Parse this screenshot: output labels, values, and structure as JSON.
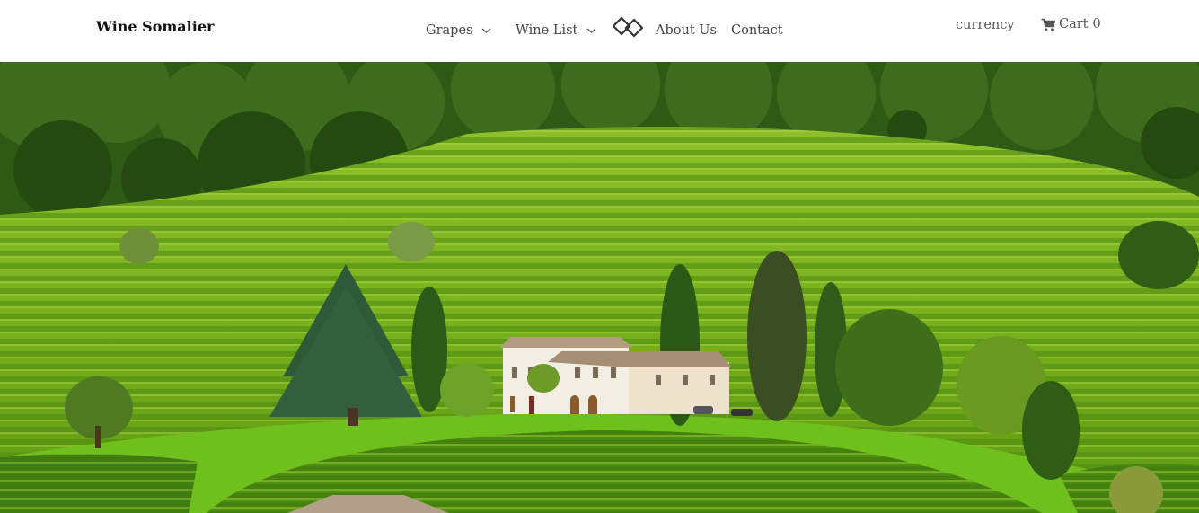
{
  "brand": {
    "name": "Wine Somalier"
  },
  "nav": {
    "items": [
      {
        "label": "Grapes",
        "has_dropdown": true
      },
      {
        "label": "Wine List",
        "has_dropdown": true
      },
      {
        "label": "About Us",
        "has_dropdown": false
      },
      {
        "label": "Contact",
        "has_dropdown": false
      }
    ],
    "logo_icon": "interlocking-diamond-logo"
  },
  "utility": {
    "currency_label": "currency",
    "cart_label": "Cart",
    "cart_count": "0",
    "cart_icon": "shopping-cart-icon"
  },
  "hero": {
    "image_subject": "terraced vineyard hillside with villa"
  },
  "colors": {
    "header_bg": "#ffffff",
    "text": "#444444",
    "brand_text": "#111111"
  }
}
